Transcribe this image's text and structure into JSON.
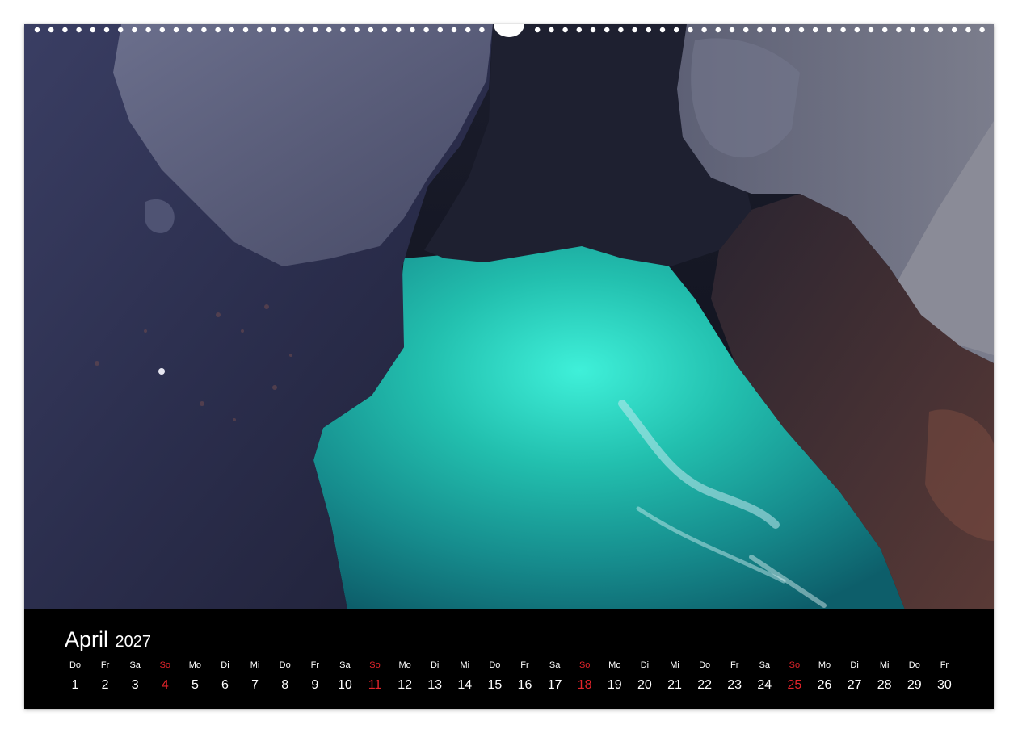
{
  "calendar": {
    "month": "April",
    "year": "2027",
    "sunday_color": "#e3242b",
    "days": [
      {
        "wd": "Do",
        "num": "1"
      },
      {
        "wd": "Fr",
        "num": "2"
      },
      {
        "wd": "Sa",
        "num": "3"
      },
      {
        "wd": "So",
        "num": "4",
        "sunday": true
      },
      {
        "wd": "Mo",
        "num": "5"
      },
      {
        "wd": "Di",
        "num": "6"
      },
      {
        "wd": "Mi",
        "num": "7"
      },
      {
        "wd": "Do",
        "num": "8"
      },
      {
        "wd": "Fr",
        "num": "9"
      },
      {
        "wd": "Sa",
        "num": "10"
      },
      {
        "wd": "So",
        "num": "11",
        "sunday": true
      },
      {
        "wd": "Mo",
        "num": "12"
      },
      {
        "wd": "Di",
        "num": "13"
      },
      {
        "wd": "Mi",
        "num": "14"
      },
      {
        "wd": "Do",
        "num": "15"
      },
      {
        "wd": "Fr",
        "num": "16"
      },
      {
        "wd": "Sa",
        "num": "17"
      },
      {
        "wd": "So",
        "num": "18",
        "sunday": true
      },
      {
        "wd": "Mo",
        "num": "19"
      },
      {
        "wd": "Di",
        "num": "20"
      },
      {
        "wd": "Mi",
        "num": "21"
      },
      {
        "wd": "Do",
        "num": "22"
      },
      {
        "wd": "Fr",
        "num": "23"
      },
      {
        "wd": "Sa",
        "num": "24"
      },
      {
        "wd": "So",
        "num": "25",
        "sunday": true
      },
      {
        "wd": "Mo",
        "num": "26"
      },
      {
        "wd": "Di",
        "num": "27"
      },
      {
        "wd": "Mi",
        "num": "28"
      },
      {
        "wd": "Do",
        "num": "29"
      },
      {
        "wd": "Fr",
        "num": "30"
      }
    ]
  }
}
